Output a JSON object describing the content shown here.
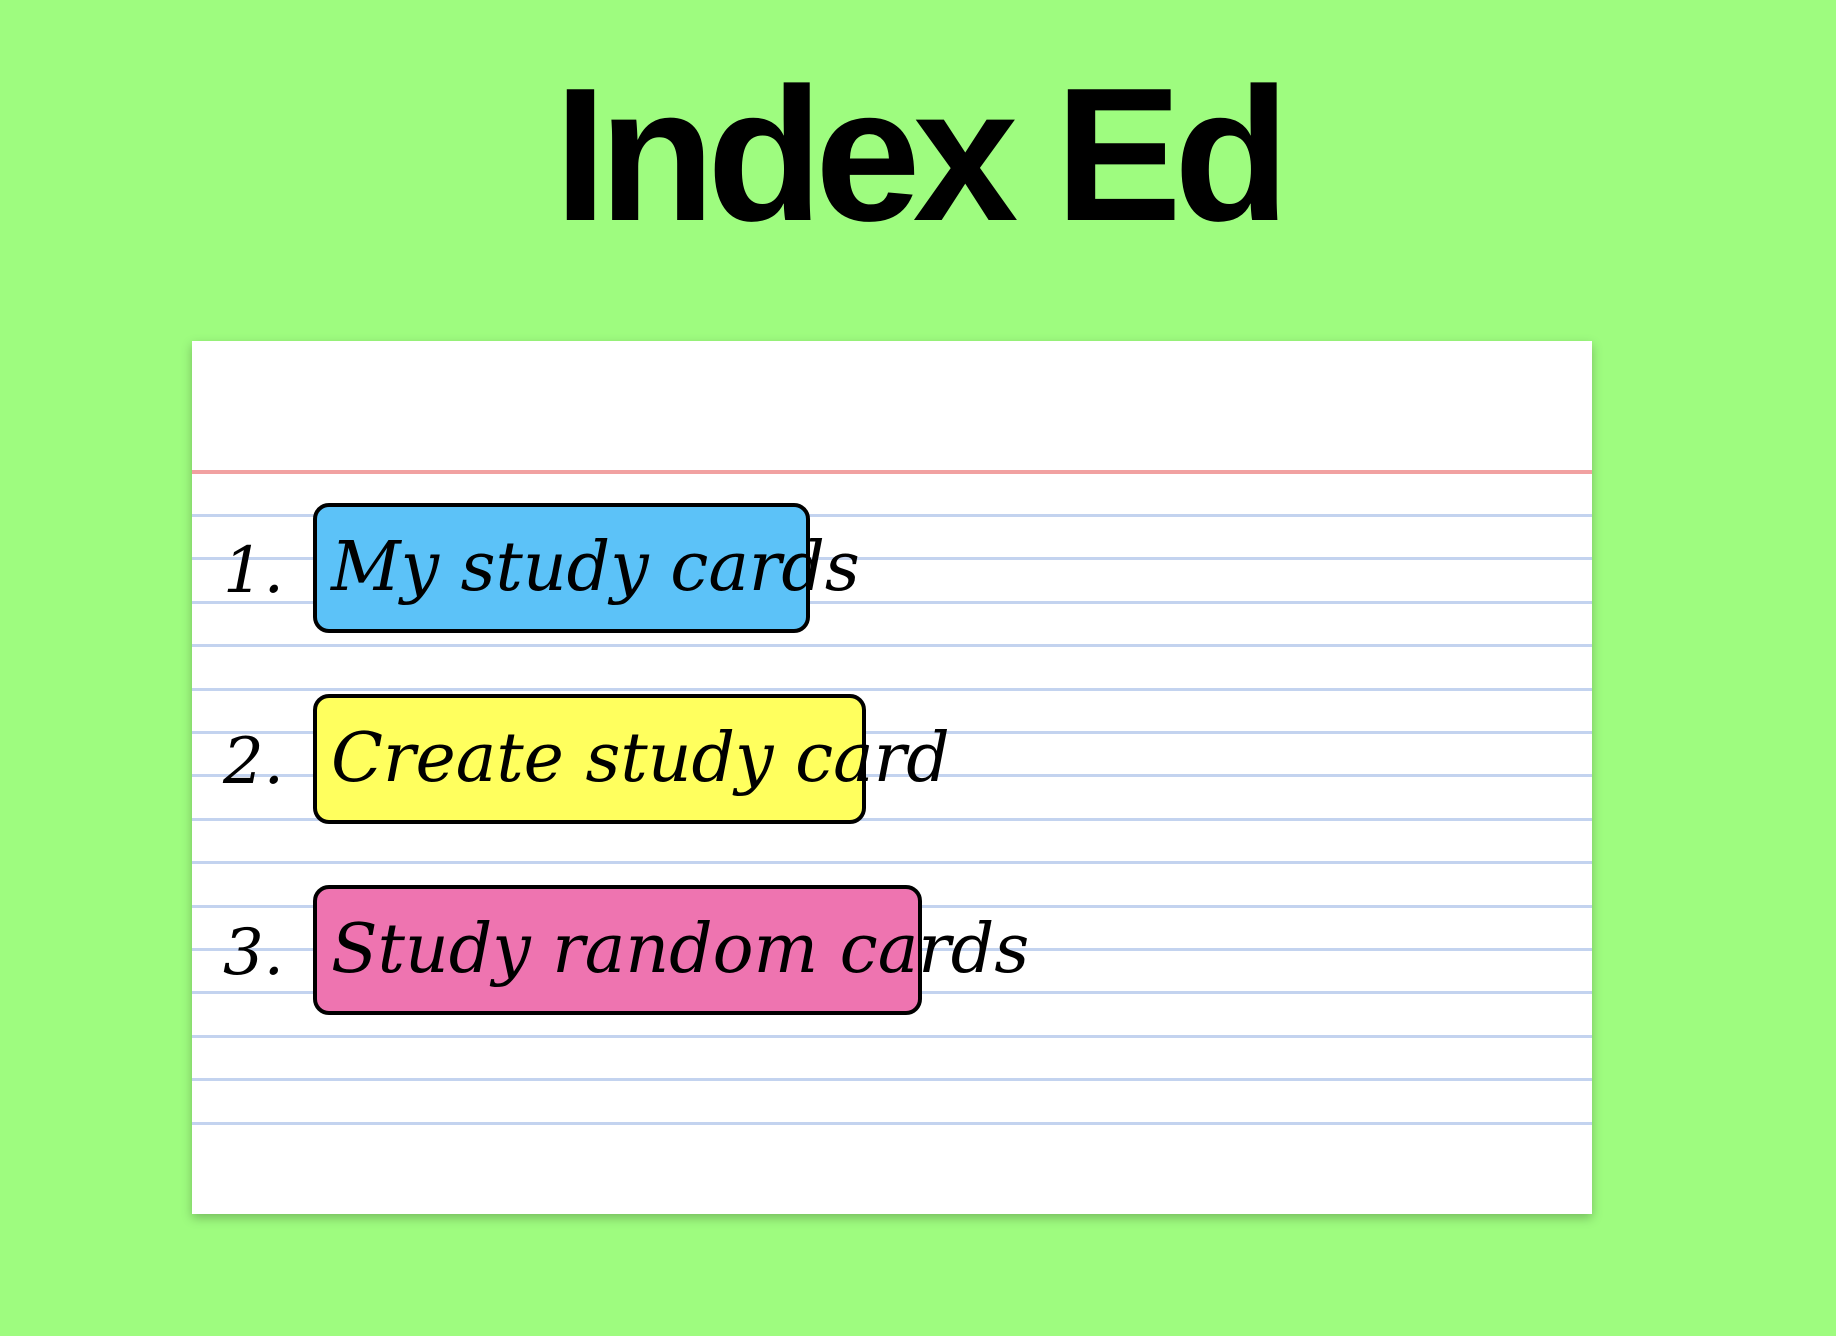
{
  "app": {
    "title": "Index Ed"
  },
  "colors": {
    "background": "#9efc7f",
    "card": "#ffffff",
    "header_line": "#f1a1a1",
    "rule_line": "#c3d3ef"
  },
  "menu": {
    "items": [
      {
        "number": "1.",
        "label": "My study cards",
        "color": "#5cc2f8"
      },
      {
        "number": "2.",
        "label": "Create study card",
        "color": "#ffff5e"
      },
      {
        "number": "3.",
        "label": "Study random cards",
        "color": "#ee74b0"
      }
    ]
  }
}
